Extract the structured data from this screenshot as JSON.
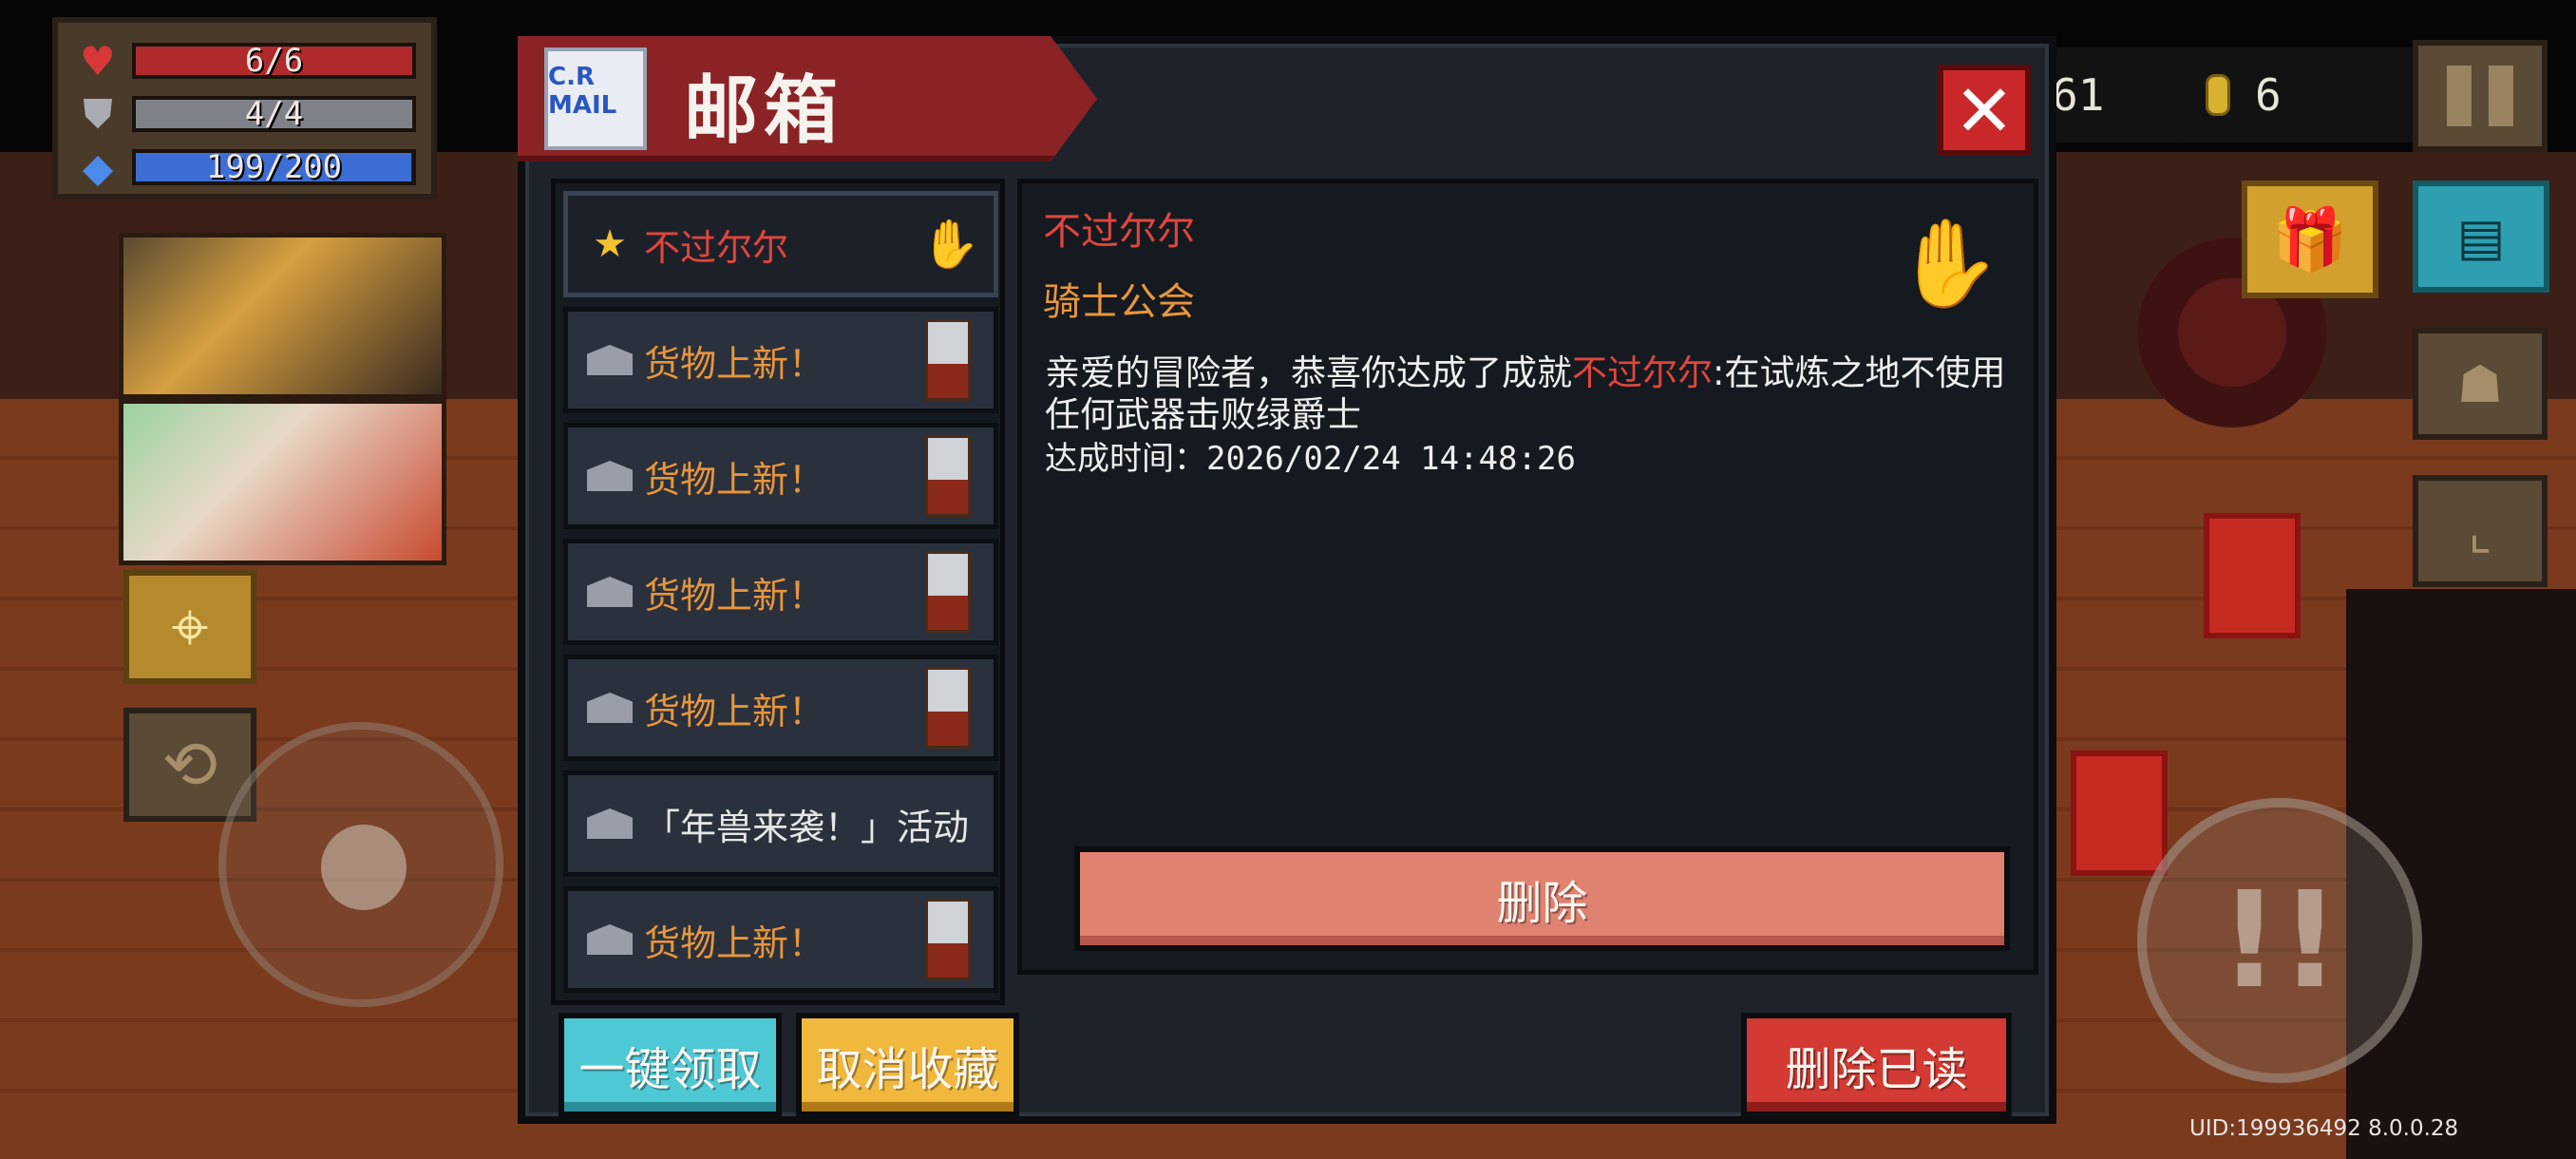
{
  "hud": {
    "health": "6/6",
    "armor": "4/4",
    "energy": "199/200",
    "health_fraction": 1.0,
    "armor_fraction": 1.0,
    "energy_fraction": 0.995,
    "gems_partial": "61",
    "coins": "6",
    "uid": "UID:199936492 8.0.0.28"
  },
  "mailbox": {
    "title": "邮箱",
    "envelope_label": "C.R MAIL",
    "close_icon": "close-icon",
    "mails": [
      {
        "label": "不过尔尔",
        "icon": "star-icon",
        "color": "red",
        "thumb": "green-hand-icon"
      },
      {
        "label": "货物上新！",
        "icon": "envelope-icon",
        "color": "orange",
        "thumb": "robot-icon"
      },
      {
        "label": "货物上新！",
        "icon": "envelope-icon",
        "color": "orange",
        "thumb": "robot-icon"
      },
      {
        "label": "货物上新！",
        "icon": "envelope-icon",
        "color": "orange",
        "thumb": "robot-icon"
      },
      {
        "label": "货物上新！",
        "icon": "envelope-icon",
        "color": "orange",
        "thumb": "robot-icon"
      },
      {
        "label": "「年兽来袭！」活动",
        "icon": "envelope-icon",
        "color": "white",
        "thumb": ""
      },
      {
        "label": "货物上新！",
        "icon": "envelope-icon",
        "color": "orange",
        "thumb": "robot-icon"
      }
    ],
    "detail": {
      "sender": "不过尔尔",
      "guild": "骑士公会",
      "body_prefix": "亲爱的冒险者，恭喜你达成了成就",
      "body_highlight": "不过尔尔",
      "body_suffix": ":在试炼之地不使用任何武器击败绿爵士",
      "time": "达成时间：2026/02/24 14:48:26"
    },
    "buttons": {
      "delete": "删除",
      "claim_all": "一键领取",
      "unfavorite": "取消收藏",
      "delete_read": "删除已读"
    }
  },
  "colors": {
    "title_banner": "#8b2326",
    "claim_button": "#4ec8d4",
    "unfavorite_button": "#f0b83c",
    "delete_read_button": "#d33a34",
    "delete_button": "#e08270",
    "mail_orange": "#e8953c",
    "mail_red": "#e2453c"
  }
}
